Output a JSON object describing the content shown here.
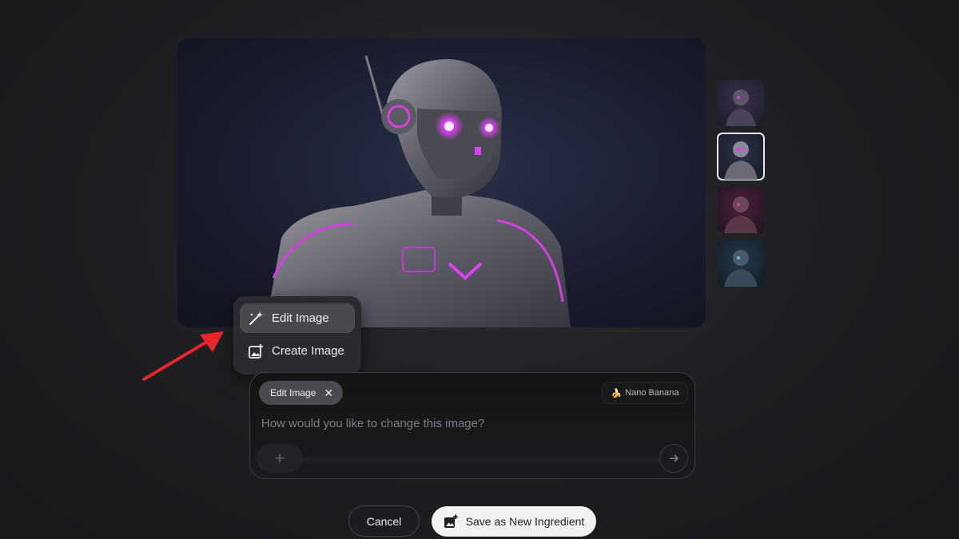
{
  "thumbnails": [
    {
      "label": "variant-1",
      "selected": false
    },
    {
      "label": "variant-2",
      "selected": true
    },
    {
      "label": "variant-3",
      "selected": false
    },
    {
      "label": "variant-4",
      "selected": false
    }
  ],
  "menu": {
    "items": [
      {
        "label": "Edit Image",
        "icon": "magic-wand-icon",
        "active": true
      },
      {
        "label": "Create Image",
        "icon": "add-image-icon",
        "active": false
      }
    ]
  },
  "prompt": {
    "chip_label": "Edit Image",
    "chip_close": "✕",
    "model_label": "Nano Banana",
    "model_emoji": "🍌",
    "placeholder": "How would you like to change this image?",
    "add_symbol": "+",
    "send_symbol": "→"
  },
  "actions": {
    "cancel_label": "Cancel",
    "save_label": "Save as New Ingredient"
  },
  "colors": {
    "accent_glow": "#e040fb",
    "annotation_arrow": "#e8242c"
  }
}
